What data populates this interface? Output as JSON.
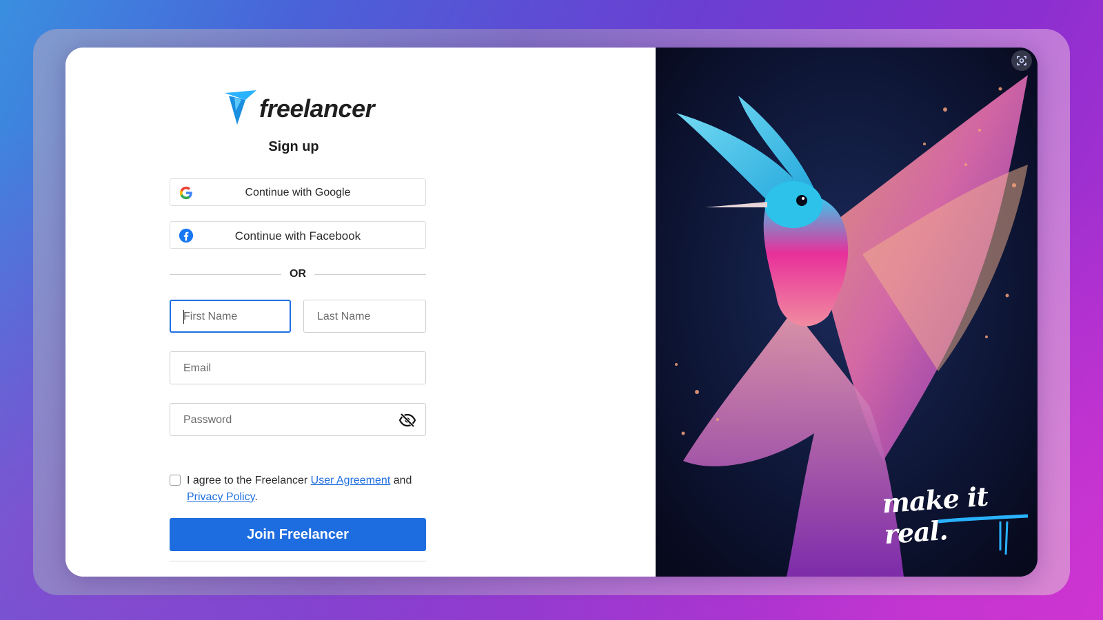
{
  "brand": {
    "name": "freelancer",
    "accent_color": "#29b2fe",
    "primary_button_color": "#1e6de0"
  },
  "page": {
    "title": "Sign up"
  },
  "sso": {
    "google_label": "Continue with Google",
    "google_icon": "google-g-icon",
    "facebook_label": "Continue with Facebook",
    "facebook_icon": "facebook-icon"
  },
  "divider": {
    "text": "OR"
  },
  "form": {
    "first_name": {
      "placeholder": "First Name",
      "value": "",
      "focused": true
    },
    "last_name": {
      "placeholder": "Last Name",
      "value": ""
    },
    "email": {
      "placeholder": "Email",
      "value": ""
    },
    "password": {
      "placeholder": "Password",
      "value": "",
      "toggle_icon": "eye-off-icon"
    }
  },
  "agreement": {
    "checked": false,
    "prefix": "I agree to the Freelancer ",
    "link1": "User Agreement",
    "middle": " and",
    "link2": "Privacy Policy",
    "suffix": "."
  },
  "submit": {
    "label": "Join Freelancer"
  },
  "hero": {
    "tagline": "make it real.",
    "subject": "hummingbird-artwork",
    "scan_icon": "screenshot-scan-icon"
  }
}
